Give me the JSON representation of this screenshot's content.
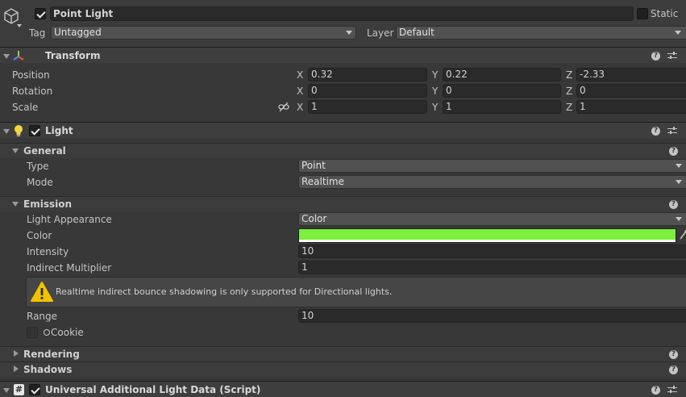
{
  "gameobject": {
    "name": "Point Light",
    "active": true,
    "static_label": "Static",
    "static": false,
    "tag_label": "Tag",
    "tag_value": "Untagged",
    "layer_label": "Layer",
    "layer_value": "Default"
  },
  "transform": {
    "title": "Transform",
    "position_label": "Position",
    "rotation_label": "Rotation",
    "scale_label": "Scale",
    "x_axis": "X",
    "y_axis": "Y",
    "z_axis": "Z",
    "position": {
      "x": "0.32",
      "y": "0.22",
      "z": "-2.33"
    },
    "rotation": {
      "x": "0",
      "y": "0",
      "z": "0"
    },
    "scale": {
      "x": "1",
      "y": "1",
      "z": "1"
    }
  },
  "light": {
    "title": "Light",
    "enabled": true,
    "general": {
      "title": "General",
      "type_label": "Type",
      "type_value": "Point",
      "mode_label": "Mode",
      "mode_value": "Realtime"
    },
    "emission": {
      "title": "Emission",
      "appearance_label": "Light Appearance",
      "appearance_value": "Color",
      "color_label": "Color",
      "color_hex": "#7cf03c",
      "intensity_label": "Intensity",
      "intensity_value": "10",
      "indirect_label": "Indirect Multiplier",
      "indirect_value": "1",
      "warning_text": "Realtime indirect bounce shadowing is only supported for Directional lights.",
      "range_label": "Range",
      "range_value": "10",
      "cookie_label": "Cookie"
    },
    "rendering_title": "Rendering",
    "shadows_title": "Shadows"
  },
  "urp": {
    "title": "Universal Additional Light Data (Script)",
    "enabled": true
  },
  "icons": {
    "gameobject": "cube-icon",
    "transform": "transform-axes-icon",
    "light": "lightbulb-icon",
    "script": "script-hash-icon",
    "help": "help-icon",
    "presets": "presets-sliders-icon",
    "warning": "warning-icon",
    "constrain": "constrain-proportions-icon"
  },
  "colors": {
    "panel_bg": "#383838",
    "field_bg": "#2a2a2a",
    "warning_yellow": "#f2c200",
    "light_bulb": "#f5d443"
  }
}
